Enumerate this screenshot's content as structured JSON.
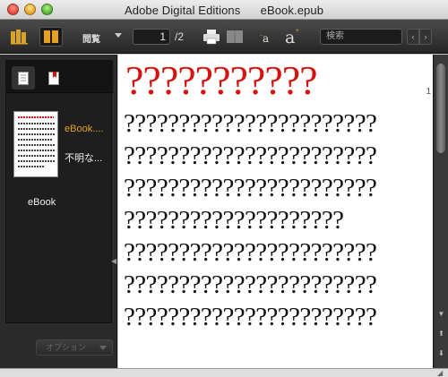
{
  "window": {
    "title": "Adobe Digital Editions      eBook.epub"
  },
  "toolbar": {
    "view_label": "閲覧",
    "page_current": "1",
    "page_total": "/2",
    "font_small": "a",
    "font_large": "a",
    "search_placeholder": "検索",
    "prev_label": "‹",
    "next_label": "›"
  },
  "sidebar": {
    "book_title": "eBook....",
    "book_author": "不明な...",
    "item_label": "eBook",
    "options_label": "オプション"
  },
  "content": {
    "heading": "???????????",
    "page_number": "1",
    "lines": [
      "???????????????????????",
      "???????????????????????",
      "???????????????????????",
      "????????????????????",
      "???????????????????????",
      "???????????????????????",
      "???????????????????????"
    ]
  },
  "colors": {
    "heading": "#d6120f",
    "book_title": "#e6a11f",
    "toolbar_bg": "#2b2b2b"
  }
}
